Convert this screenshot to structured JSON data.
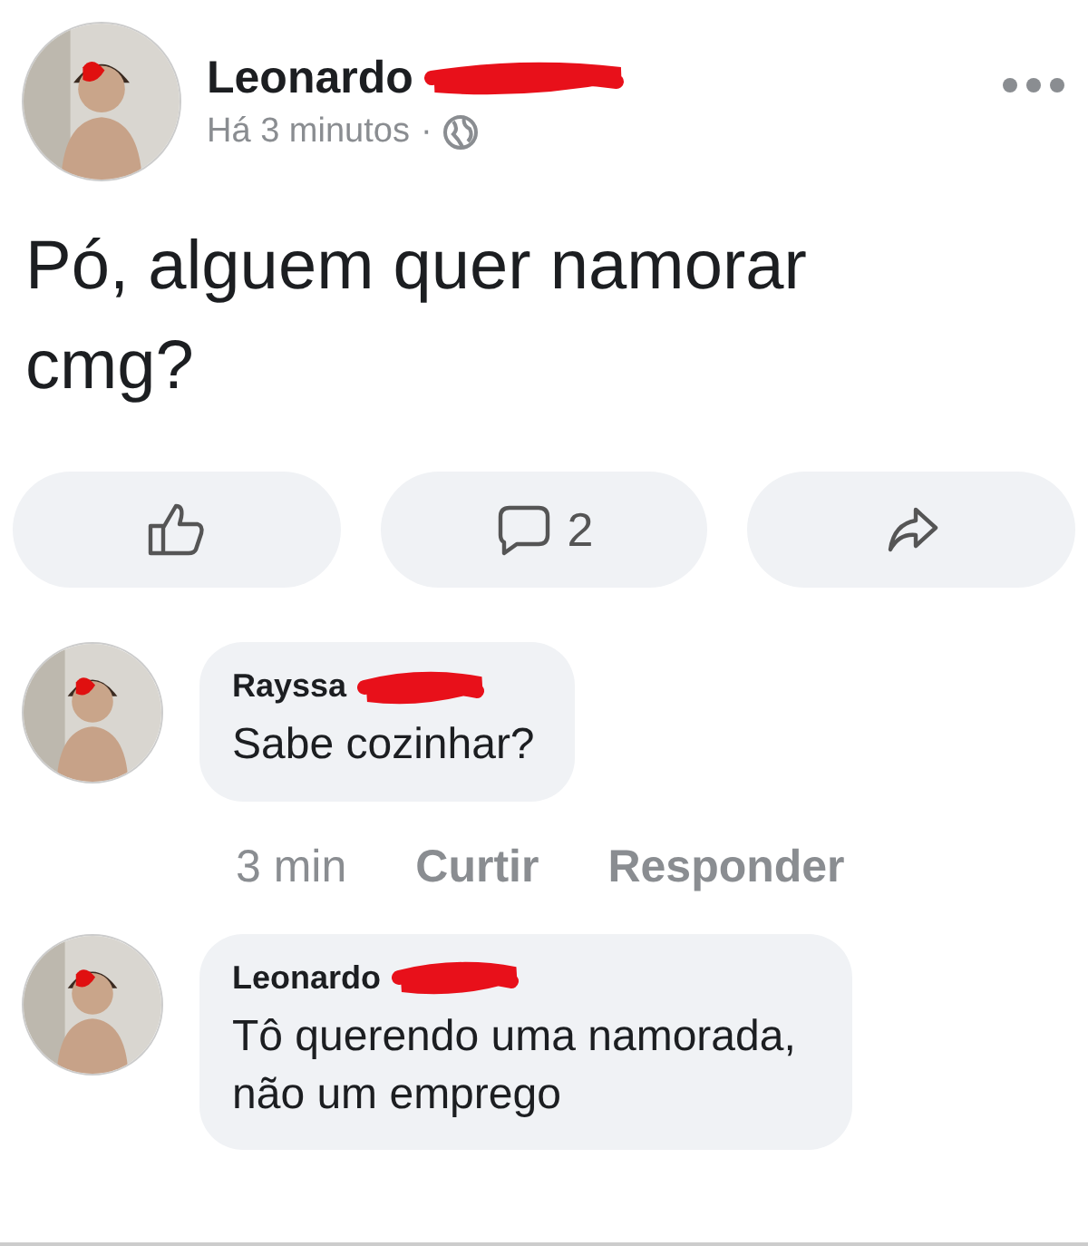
{
  "post": {
    "author": "Leonardo",
    "time": "Há 3 minutos",
    "separator": "·",
    "text": "Pó, alguem quer namorar cmg?"
  },
  "actions": [
    {
      "kind": "like"
    },
    {
      "kind": "comment",
      "count": "2"
    },
    {
      "kind": "share"
    }
  ],
  "comments": [
    {
      "author": "Rayssa",
      "text": "Sabe cozinhar?",
      "time": "3 min",
      "buttons": [
        "Curtir",
        "Responder"
      ]
    },
    {
      "author": "Leonardo",
      "text": "Tô querendo uma namorada, não um emprego"
    }
  ]
}
